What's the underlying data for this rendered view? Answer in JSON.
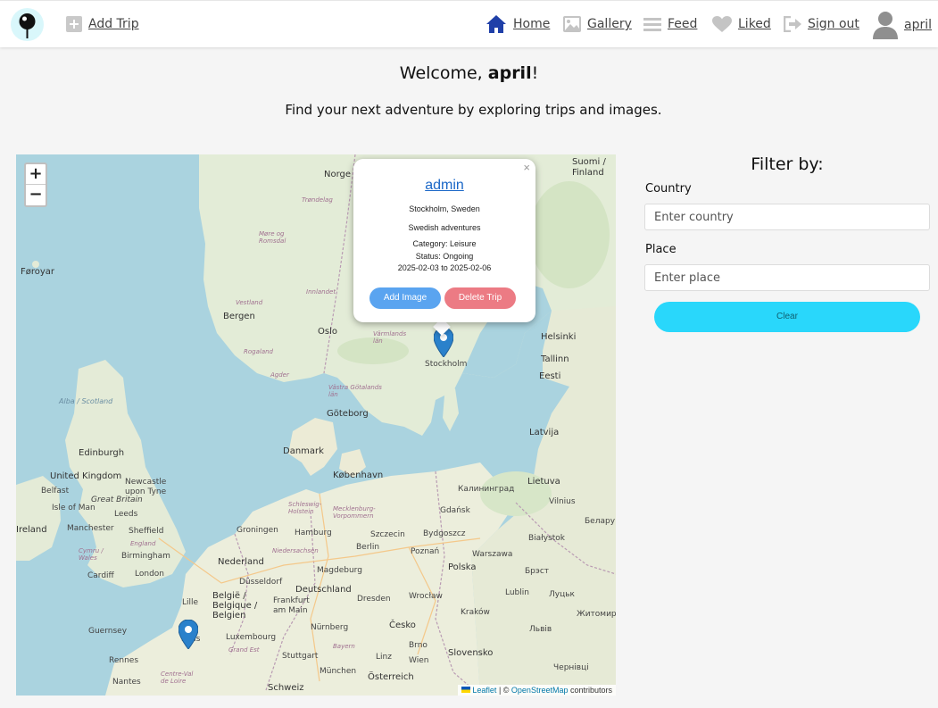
{
  "nav": {
    "add_trip": "Add Trip",
    "home": "Home",
    "gallery": "Gallery",
    "feed": "Feed",
    "liked": "Liked",
    "sign_out": "Sign out",
    "username": "april"
  },
  "header": {
    "welcome_prefix": "Welcome, ",
    "welcome_name": "april",
    "welcome_suffix": "!",
    "tagline": "Find your next adventure by exploring trips and images."
  },
  "map": {
    "zoom_in": "+",
    "zoom_out": "−",
    "popup": {
      "close": "×",
      "user": "admin",
      "location": "Stockholm, Sweden",
      "title": "Swedish adventures",
      "category": "Category: Leisure",
      "status": "Status: Ongoing",
      "dates": "2025-02-03 to 2025-02-06",
      "add_image": "Add Image",
      "delete_trip": "Delete Trip"
    },
    "attribution": {
      "leaflet": "Leaflet",
      "separator": " | © ",
      "osm": "OpenStreetMap",
      "contributors": " contributors"
    },
    "labels": {
      "norge": "Norge",
      "suomi": "Suomi / Finland",
      "faroyar": "Føroyar",
      "bergen": "Bergen",
      "oslo": "Oslo",
      "stockholm": "Stockholm",
      "helsinki": "Helsinki",
      "tallinn": "Tallinn",
      "eesti": "Eesti",
      "goteborg": "Göteborg",
      "latvija": "Latvija",
      "danmark": "Danmark",
      "kobenhavn": "København",
      "edinburgh": "Edinburgh",
      "alba": "Alba / Scotland",
      "uk": "United Kingdom",
      "newcastle": "Newcastle upon Tyne",
      "belfast": "Belfast",
      "great_britain": "Great Britain",
      "isle_of_man": "Isle of Man",
      "leeds": "Leeds",
      "ireland": "Ireland",
      "manchester": "Manchester",
      "sheffield": "Sheffield",
      "england": "England",
      "birmingham": "Birmingham",
      "cymru": "Cymru / Wales",
      "cardiff": "Cardiff",
      "london": "London",
      "lietuva": "Lietuva",
      "vilnius": "Vilnius",
      "kaliningrad": "Калининград",
      "gdansk": "Gdańsk",
      "belarus": "Белару",
      "groningen": "Groningen",
      "hamburg": "Hamburg",
      "szczecin": "Szczecin",
      "bydgoszcz": "Bydgoszcz",
      "bialystok": "Białystok",
      "berlin": "Berlin",
      "poznan": "Poznań",
      "warszawa": "Warszawa",
      "nederland": "Nederland",
      "polska": "Polska",
      "brest": "Брэст",
      "magdeburg": "Magdeburg",
      "dusseldorf": "Düsseldorf",
      "belgie": "België / Belgique / Belgien",
      "deutschland": "Deutschland",
      "frankfurt": "Frankfurt am Main",
      "dresden": "Dresden",
      "wroclaw": "Wrocław",
      "lublin": "Lublin",
      "lutsk": "Луцьк",
      "lille": "Lille",
      "krakow": "Kraków",
      "zhytomyr": "Житомир",
      "guernsey": "Guernsey",
      "luxembourg": "Luxembourg",
      "nurnberg": "Nürnberg",
      "cesko": "Česko",
      "lviv": "Львів",
      "paris": "Paris",
      "brno": "Brno",
      "slovensko": "Slovensko",
      "rennes": "Rennes",
      "stuttgart": "Stuttgart",
      "linz": "Linz",
      "wien": "Wien",
      "munchen": "München",
      "osterreich": "Österreich",
      "chernivtsi": "Чернівці",
      "nantes": "Nantes",
      "schweiz": "Schweiz",
      "grand_est": "Grand Est",
      "bayern": "Bayern",
      "centre": "Centre-Val de Loire",
      "rogaland": "Rogaland",
      "vestland": "Vestland",
      "innlandet": "Innlandet",
      "trondelag": "Trøndelag",
      "more": "Møre og Romsdal",
      "agder": "Agder",
      "vastra": "Västra Götalands län",
      "varmlands": "Värmlands län",
      "schleswig": "Schleswig-Holstein",
      "mecklenburg": "Mecklenburg-Vorpommern",
      "niedersachsen": "Niedersachsen"
    }
  },
  "filter": {
    "title": "Filter by:",
    "country_label": "Country",
    "country_placeholder": "Enter country",
    "place_label": "Place",
    "place_placeholder": "Enter place",
    "clear_label": "Clear"
  },
  "colors": {
    "accent": "#29d7fb",
    "home_icon": "#1f3fa8",
    "add_image": "#5aa4f0",
    "delete_trip": "#ec7b84",
    "marker": "#2a81cb"
  }
}
